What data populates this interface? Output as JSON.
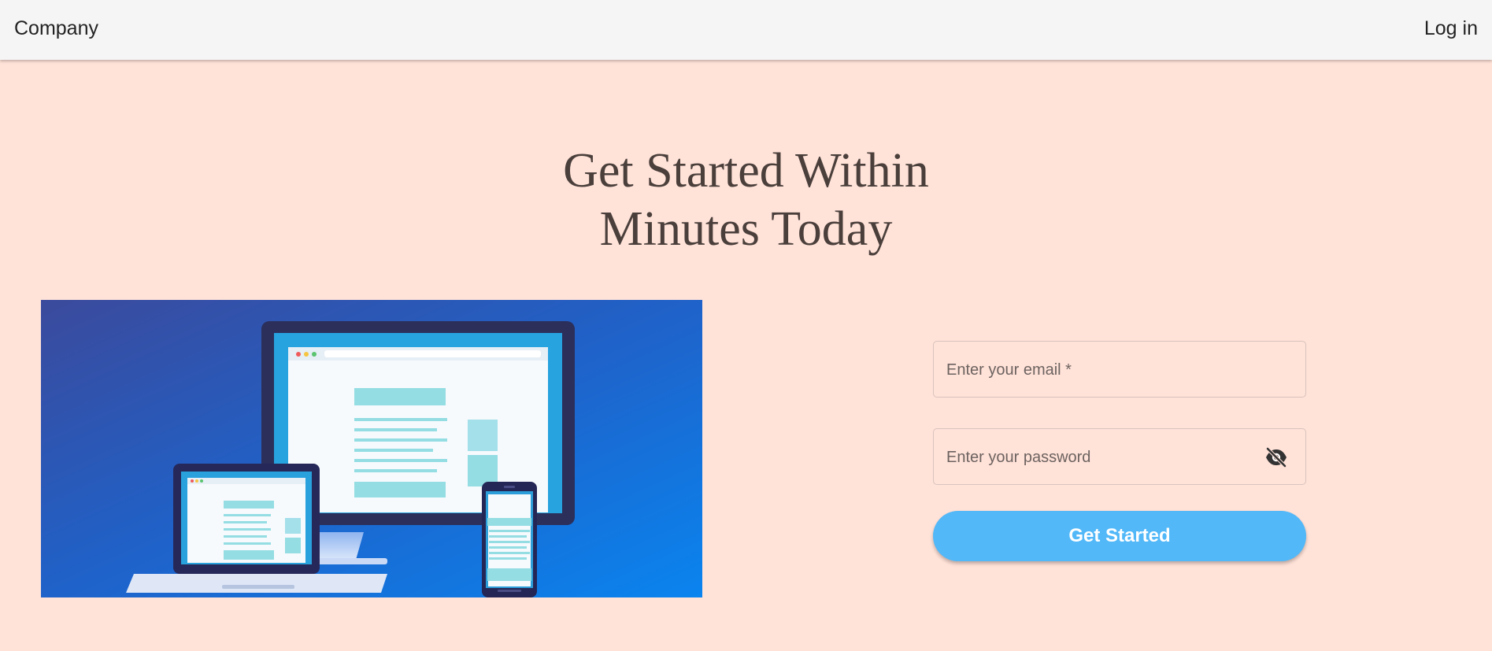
{
  "navbar": {
    "brand": "Company",
    "login_label": "Log in"
  },
  "hero": {
    "headline_line1": "Get Started Within",
    "headline_line2": "Minutes Today",
    "illustration": "responsive-devices-illustration"
  },
  "form": {
    "email_placeholder": "Enter your email *",
    "email_value": "",
    "password_placeholder": "Enter your password",
    "password_value": "",
    "password_toggle_icon": "eye-off-icon",
    "submit_label": "Get Started"
  },
  "colors": {
    "background": "#ffe2d8",
    "navbar": "#f5f5f5",
    "accent": "#52b8f8",
    "headline": "#4a3f3b"
  }
}
